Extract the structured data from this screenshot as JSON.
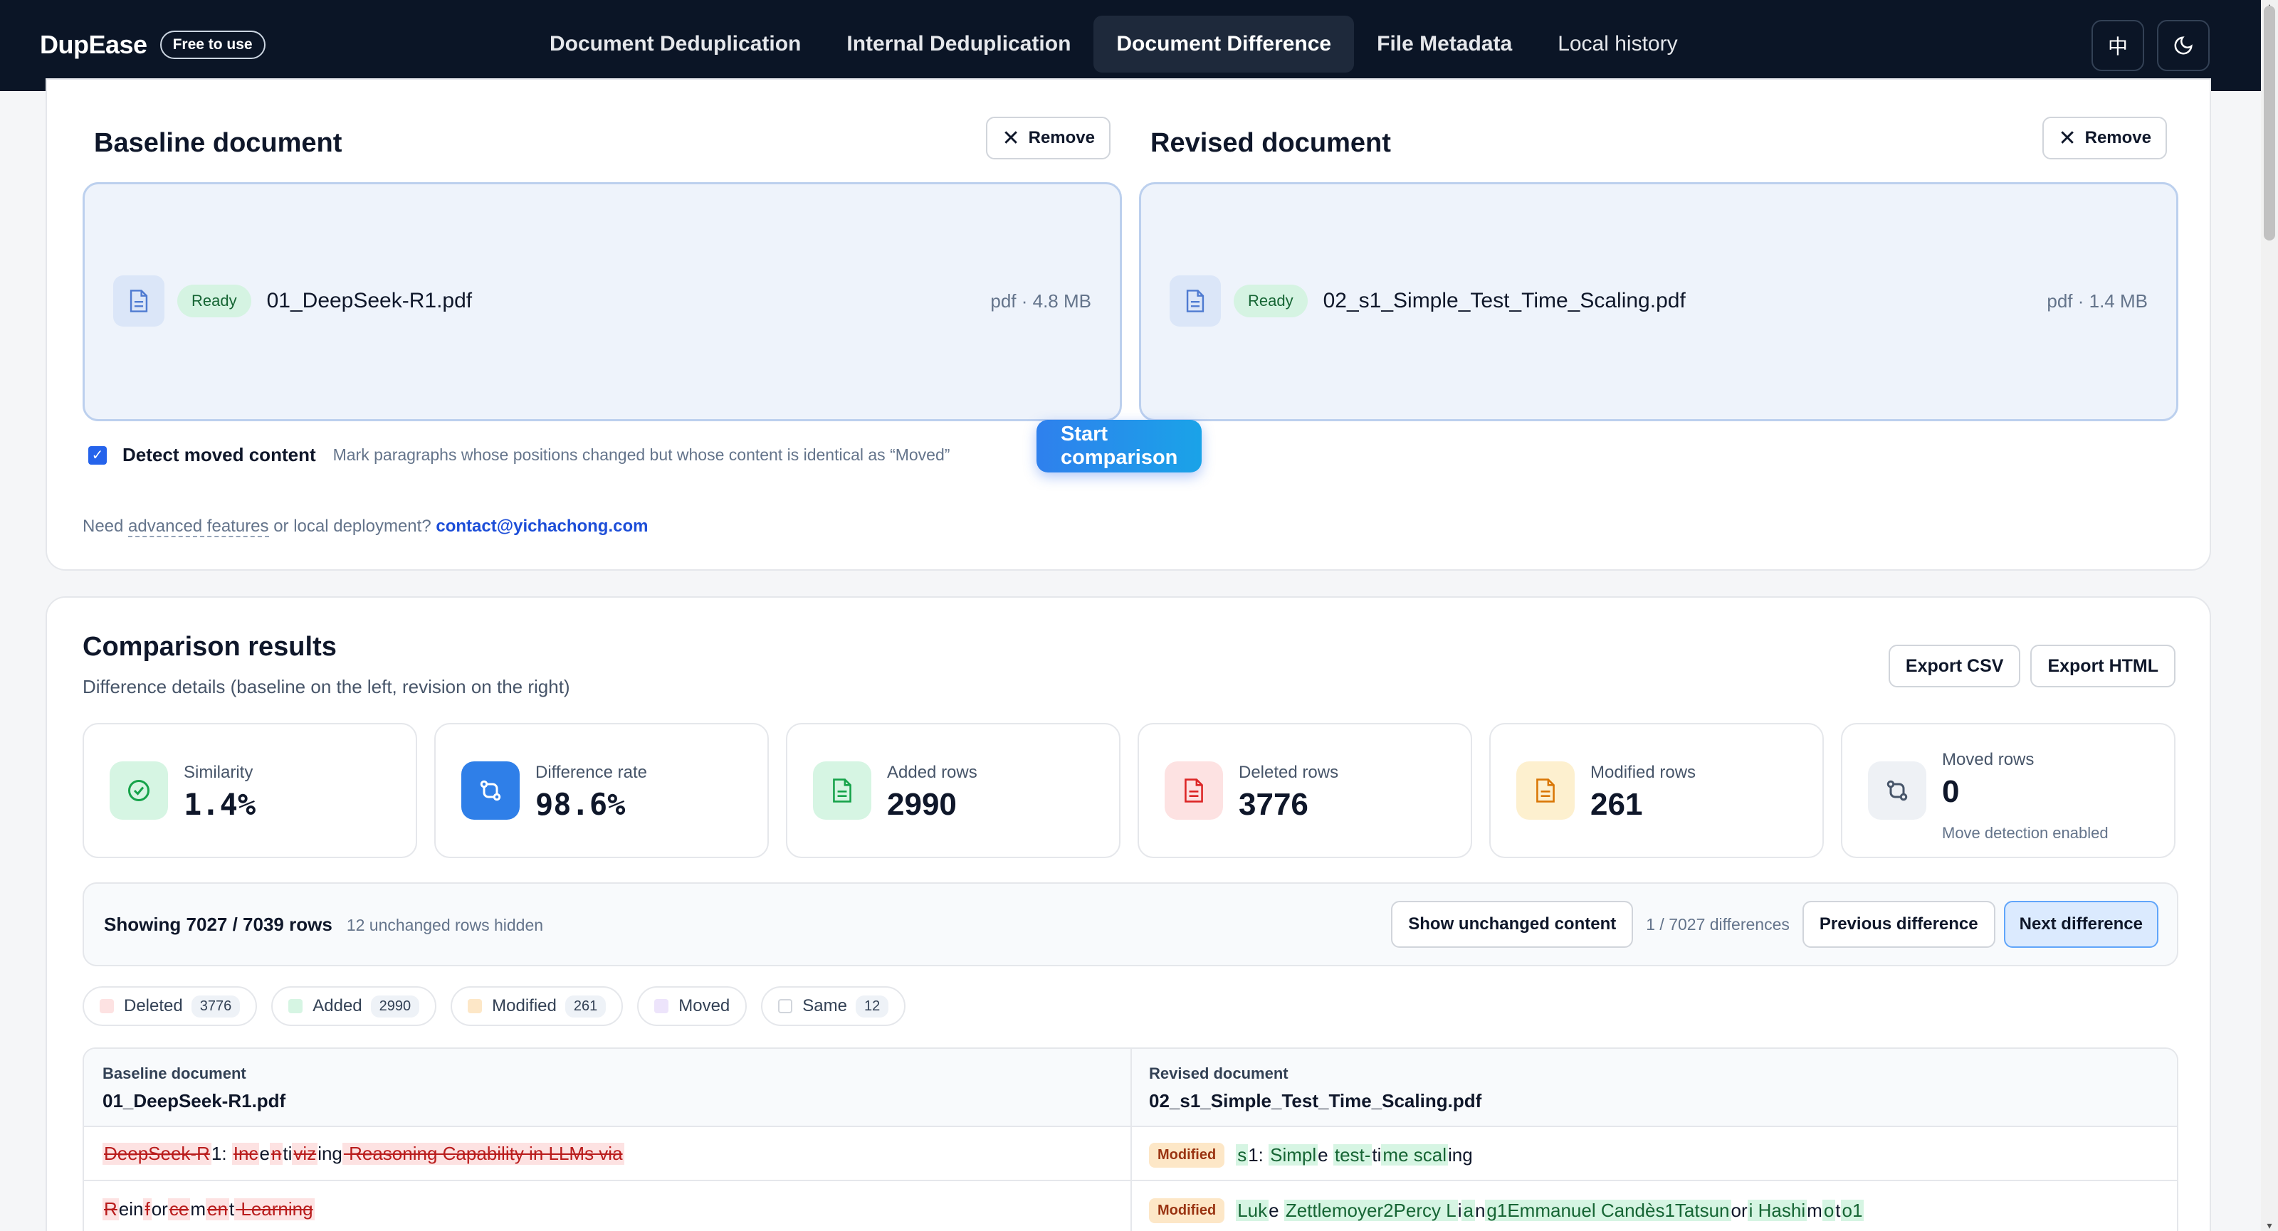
{
  "header": {
    "brand": "DupEase",
    "badge": "Free to use",
    "nav": [
      {
        "label": "Document Deduplication"
      },
      {
        "label": "Internal Deduplication"
      },
      {
        "label": "Document Difference",
        "active": true
      },
      {
        "label": "File Metadata"
      },
      {
        "label": "Local history"
      }
    ],
    "lang_icon": "中",
    "theme_icon": "moon-icon"
  },
  "upload": {
    "baseline": {
      "title": "Baseline document",
      "remove_label": "Remove",
      "status": "Ready",
      "file_name": "01_DeepSeek-R1.pdf",
      "file_meta": "pdf · 4.8 MB"
    },
    "revised": {
      "title": "Revised document",
      "remove_label": "Remove",
      "status": "Ready",
      "file_name": "02_s1_Simple_Test_Time_Scaling.pdf",
      "file_meta": "pdf · 1.4 MB"
    },
    "detect_moved": {
      "checked": true,
      "label": "Detect moved content",
      "hint": "Mark paragraphs whose positions changed but whose content is identical as “Moved”"
    },
    "start_label": "Start comparison",
    "need_prefix": "Need",
    "need_link": "advanced features",
    "need_middle": "or local deployment?",
    "contact_email": "contact@yichachong.com"
  },
  "results": {
    "title": "Comparison results",
    "subtitle": "Difference details (baseline on the left, revision on the right)",
    "export_csv": "Export CSV",
    "export_html": "Export HTML",
    "stats": [
      {
        "label": "Similarity",
        "value": "1.4%"
      },
      {
        "label": "Difference rate",
        "value": "98.6%"
      },
      {
        "label": "Added rows",
        "value": "2990"
      },
      {
        "label": "Deleted rows",
        "value": "3776"
      },
      {
        "label": "Modified rows",
        "value": "261"
      },
      {
        "label": "Moved rows",
        "value": "0",
        "note": "Move detection enabled"
      }
    ],
    "toolbar": {
      "showing": "Showing 7027 / 7039 rows",
      "hidden": "12 unchanged rows hidden",
      "show_unchanged": "Show unchanged content",
      "position": "1 / 7027 differences",
      "prev": "Previous difference",
      "next": "Next difference"
    },
    "legend": [
      {
        "label": "Deleted",
        "count": "3776",
        "color": "#fde2e2"
      },
      {
        "label": "Added",
        "count": "2990",
        "color": "#d6f5e3"
      },
      {
        "label": "Modified",
        "count": "261",
        "color": "#fde7c7"
      },
      {
        "label": "Moved",
        "count": "",
        "color": "#ede4fb"
      },
      {
        "label": "Same",
        "count": "12",
        "color": "#ffffff"
      }
    ],
    "table": {
      "left_header": "Baseline document",
      "left_file": "01_DeepSeek-R1.pdf",
      "right_header": "Revised document",
      "right_file": "02_s1_Simple_Test_Time_Scaling.pdf",
      "modified_label": "Modified",
      "rows": [
        {
          "left": [
            [
              "del",
              "DeepSeek-R"
            ],
            [
              "same",
              "1: "
            ],
            [
              "del",
              "Inc"
            ],
            [
              "same",
              "e"
            ],
            [
              "del",
              "n"
            ],
            [
              "same",
              "ti"
            ],
            [
              "del",
              "viz"
            ],
            [
              "same",
              "ing"
            ],
            [
              "del",
              " Reasoning Capability in LLMs via"
            ]
          ],
          "right": [
            [
              "add",
              "s"
            ],
            [
              "same",
              "1: "
            ],
            [
              "add",
              "Simpl"
            ],
            [
              "same",
              "e "
            ],
            [
              "add",
              "test-"
            ],
            [
              "same",
              "ti"
            ],
            [
              "add",
              "me scal"
            ],
            [
              "same",
              "ing"
            ]
          ]
        },
        {
          "left": [
            [
              "del",
              "R"
            ],
            [
              "same",
              "ein"
            ],
            [
              "del",
              "f"
            ],
            [
              "same",
              "or"
            ],
            [
              "del",
              "ce"
            ],
            [
              "same",
              "m"
            ],
            [
              "del",
              "en"
            ],
            [
              "same",
              "t"
            ],
            [
              "del",
              " Learning"
            ]
          ],
          "right": [
            [
              "add",
              "Luk"
            ],
            [
              "same",
              "e "
            ],
            [
              "add",
              "Zettlemoyer2Percy L"
            ],
            [
              "same",
              "i"
            ],
            [
              "add",
              "a"
            ],
            [
              "same",
              "n"
            ],
            [
              "add",
              "g1Emmanuel Candès1Tatsun"
            ],
            [
              "same",
              "or"
            ],
            [
              "add",
              "i Hashi"
            ],
            [
              "same",
              "m"
            ],
            [
              "add",
              "o"
            ],
            [
              "same",
              "t"
            ],
            [
              "add",
              "o1"
            ]
          ]
        }
      ]
    }
  }
}
